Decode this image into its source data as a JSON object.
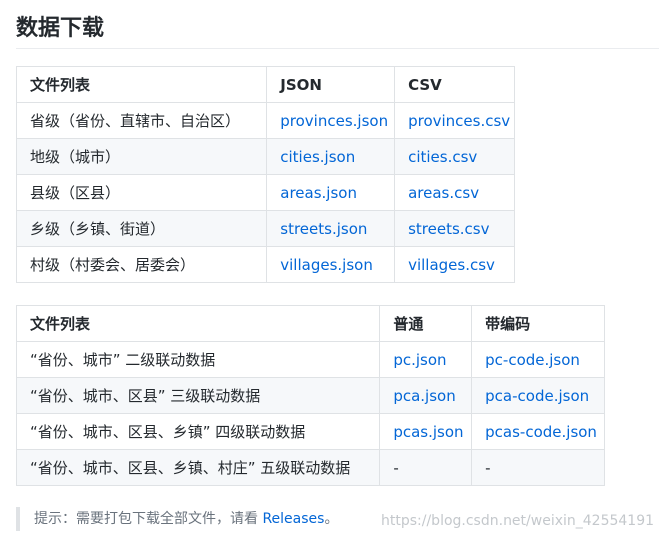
{
  "page": {
    "title": "数据下载"
  },
  "table1": {
    "headers": [
      "文件列表",
      "JSON",
      "CSV"
    ],
    "rows": [
      {
        "name": "省级（省份、直辖市、自治区）",
        "json": "provinces.json",
        "csv": "provinces.csv"
      },
      {
        "name": "地级（城市）",
        "json": "cities.json",
        "csv": "cities.csv"
      },
      {
        "name": "县级（区县）",
        "json": "areas.json",
        "csv": "areas.csv"
      },
      {
        "name": "乡级（乡镇、街道）",
        "json": "streets.json",
        "csv": "streets.csv"
      },
      {
        "name": "村级（村委会、居委会）",
        "json": "villages.json",
        "csv": "villages.csv"
      }
    ]
  },
  "table2": {
    "headers": [
      "文件列表",
      "普通",
      "带编码"
    ],
    "rows": [
      {
        "name": "“省份、城市” 二级联动数据",
        "plain": "pc.json",
        "coded": "pc-code.json"
      },
      {
        "name": "“省份、城市、区县” 三级联动数据",
        "plain": "pca.json",
        "coded": "pca-code.json"
      },
      {
        "name": "“省份、城市、区县、乡镇” 四级联动数据",
        "plain": "pcas.json",
        "coded": "pcas-code.json"
      },
      {
        "name": "“省份、城市、区县、乡镇、村庄” 五级联动数据",
        "plain": "-",
        "coded": "-"
      }
    ]
  },
  "tip": {
    "text": "提示：需要打包下载全部文件，请看",
    "link": "Releases",
    "suffix": "。"
  },
  "watermark": "https://blog.csdn.net/weixin_42554191",
  "colors": {
    "link": "#0366d6",
    "border": "#dfe2e5",
    "alt_row": "#f6f8fa",
    "text": "#24292e",
    "muted": "#6a737d"
  }
}
